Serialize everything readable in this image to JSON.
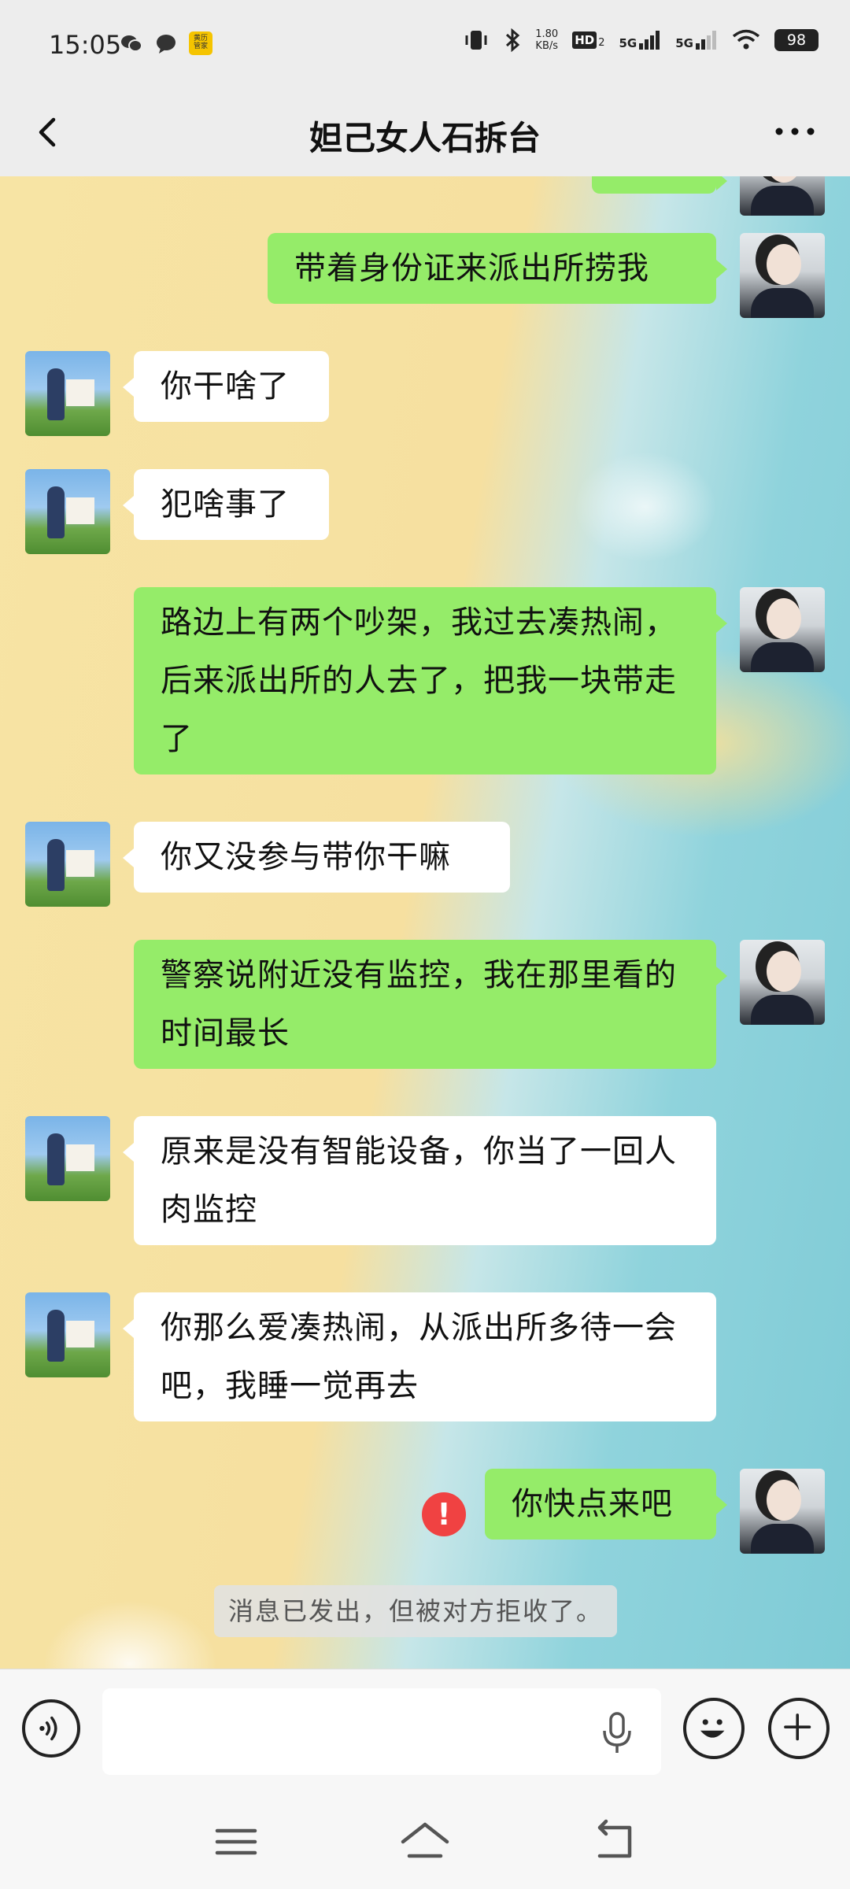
{
  "status_bar": {
    "time": "15:05",
    "app_badge_line1": "黄历",
    "app_badge_line2": "管家",
    "net_speed_value": "1.80",
    "net_speed_unit": "KB/s",
    "hd_label": "HD",
    "hd_sub": "2",
    "signal1_label": "5G",
    "signal2_label": "5G",
    "battery": "98"
  },
  "header": {
    "title": "妲己女人石拆台"
  },
  "messages": [
    {
      "side": "right",
      "text": "带着身份证来派出所捞我"
    },
    {
      "side": "left",
      "text": "你干啥了"
    },
    {
      "side": "left",
      "text": "犯啥事了"
    },
    {
      "side": "right",
      "text": "路边上有两个吵架，我过去凑热闹，后来派出所的人去了，把我一块带走了"
    },
    {
      "side": "left",
      "text": "你又没参与带你干嘛"
    },
    {
      "side": "right",
      "text": "警察说附近没有监控，我在那里看的时间最长"
    },
    {
      "side": "left",
      "text": "原来是没有智能设备，你当了一回人肉监控"
    },
    {
      "side": "left",
      "text": "你那么爱凑热闹，从派出所多待一会吧，我睡一觉再去"
    },
    {
      "side": "right",
      "text": "你快点来吧",
      "failed_mark": "!"
    }
  ],
  "system_notice": "消息已发出，但被对方拒收了。",
  "colors": {
    "sent_bubble": "#95ec69",
    "received_bubble": "#ffffff",
    "fail_badge": "#f04242"
  },
  "icons": {
    "nav_back": "chevron-left-icon",
    "nav_more": "more-dots-icon",
    "voice": "voice-toggle-icon",
    "mic": "microphone-icon",
    "emoji": "emoji-icon",
    "plus": "plus-icon",
    "sys_menu": "menu-icon",
    "sys_home": "home-icon",
    "sys_back": "back-icon"
  }
}
